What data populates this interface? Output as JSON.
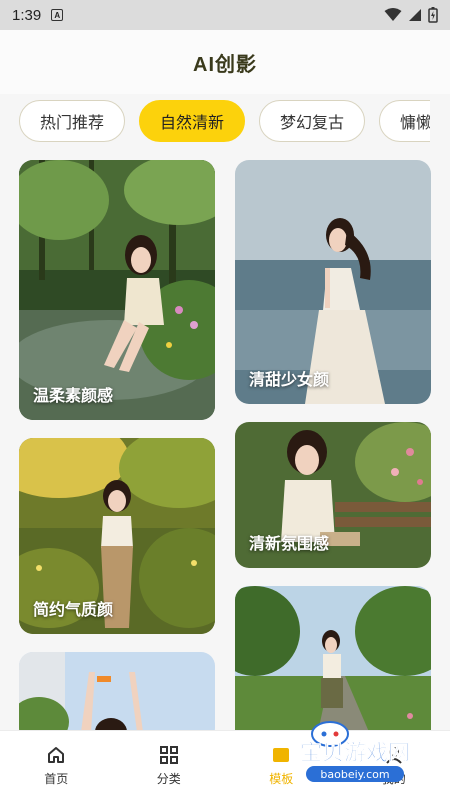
{
  "status_bar": {
    "time": "1:39",
    "notification_letter": "A"
  },
  "header": {
    "title": "AI创影"
  },
  "tabs": [
    {
      "label": "热门推荐",
      "active": false
    },
    {
      "label": "自然清新",
      "active": true
    },
    {
      "label": "梦幻复古",
      "active": false
    },
    {
      "label": "慵懒",
      "active": false
    }
  ],
  "cards": [
    {
      "label": "温柔素颜感",
      "scene": "forest-stream"
    },
    {
      "label": "清甜少女颜",
      "scene": "seaside-dress"
    },
    {
      "label": "简约气质颜",
      "scene": "sunlit-meadow"
    },
    {
      "label": "清新氛围感",
      "scene": "bench-reading"
    },
    {
      "label": "",
      "scene": "sky-arms-raised"
    },
    {
      "label": "",
      "scene": "park-path"
    }
  ],
  "bottom_nav": [
    {
      "label": "首页",
      "icon": "home-icon",
      "active": false
    },
    {
      "label": "分类",
      "icon": "grid-icon",
      "active": false
    },
    {
      "label": "模板",
      "icon": "template-icon",
      "active": true
    },
    {
      "label": "我的",
      "icon": "user-icon",
      "active": false
    }
  ],
  "watermark": {
    "text": "宝贝游戏网",
    "url": "baobeiy.com"
  },
  "colors": {
    "accent": "#fcd20c",
    "active_nav": "#f0b400",
    "background": "#f6f6f6"
  }
}
